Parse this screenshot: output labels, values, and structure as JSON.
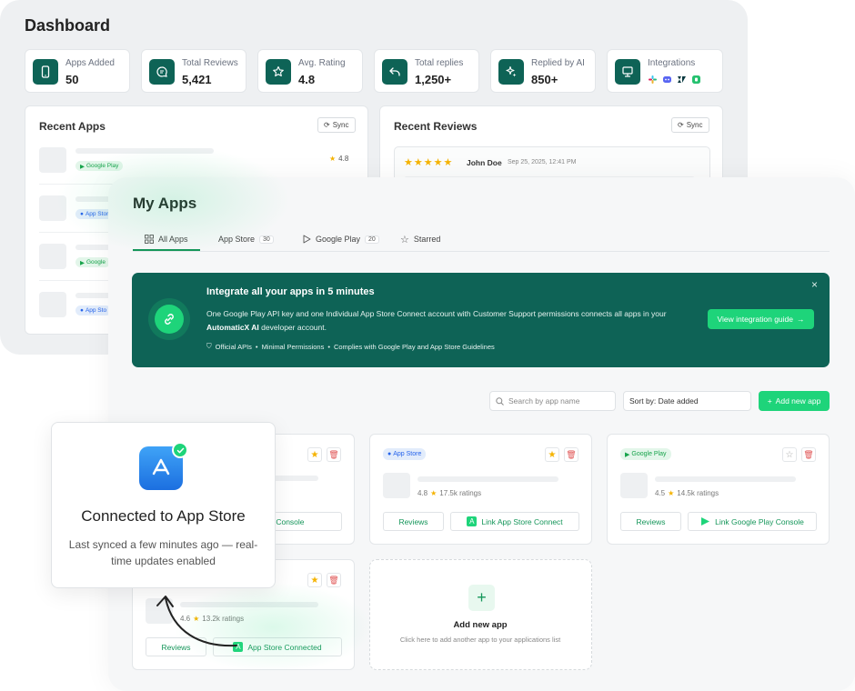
{
  "dashboard": {
    "title": "Dashboard",
    "stats": [
      {
        "label": "Apps Added",
        "value": "50",
        "icon": "phone-icon"
      },
      {
        "label": "Total Reviews",
        "value": "5,421",
        "icon": "chat-icon"
      },
      {
        "label": "Avg. Rating",
        "value": "4.8",
        "icon": "star-icon"
      },
      {
        "label": "Total replies",
        "value": "1,250+",
        "icon": "reply-icon"
      },
      {
        "label": "Replied by AI",
        "value": "850+",
        "icon": "sparkle-icon"
      },
      {
        "label": "Integrations",
        "value": "",
        "icon": "integrations-icon"
      }
    ],
    "recent_apps": {
      "title": "Recent Apps",
      "sync": "Sync",
      "rows": [
        {
          "badge": "Google Play",
          "rating": "4.8"
        },
        {
          "badge": "App Store"
        },
        {
          "badge": "Google"
        },
        {
          "badge": "App Sto"
        }
      ]
    },
    "recent_reviews": {
      "title": "Recent Reviews",
      "sync": "Sync",
      "reviewer": "John Doe",
      "date": "Sep 25, 2025, 12:41 PM"
    }
  },
  "my_apps": {
    "title": "My Apps",
    "tabs": [
      {
        "label": "All Apps",
        "count": ""
      },
      {
        "label": "App Store",
        "count": "30"
      },
      {
        "label": "Google Play",
        "count": "20"
      },
      {
        "label": "Starred",
        "count": ""
      }
    ],
    "banner": {
      "title": "Integrate all your apps in 5 minutes",
      "body_pre": "One Google Play API key and one Individual App Store Connect account with Customer Support permissions connects all apps in your",
      "body_bold": "AutomaticX AI",
      "body_post": "developer account.",
      "features": [
        "Official APIs",
        "Minimal Permissions",
        "Complies with Google Play and App Store Guidelines"
      ],
      "cta": "View integration guide"
    },
    "search_placeholder": "Search by app name",
    "sort_label": "Sort by: Date added",
    "add_button": "Add new app",
    "cards": [
      {
        "badge": "",
        "rating": "",
        "ratings": "",
        "reviews": "",
        "link": "le Play Console"
      },
      {
        "badge": "App Store",
        "rating": "4.8",
        "ratings": "17.5k ratings",
        "reviews": "Reviews",
        "link": "Link App Store Connect"
      },
      {
        "badge": "Google Play",
        "rating": "4.5",
        "ratings": "14.5k ratings",
        "reviews": "Reviews",
        "link": "Link Google Play Console"
      },
      {
        "badge": "",
        "rating": "4.6",
        "ratings": "13.2k ratings",
        "reviews": "Reviews",
        "link": "App Store Connected"
      }
    ],
    "add_card": {
      "title": "Add new app",
      "subtitle": "Click here to add another app to your applications list"
    }
  },
  "toast": {
    "title": "Connected to App Store",
    "body": "Last synced a few minutes ago — real-time updates enabled"
  },
  "colors": {
    "brand": "#0e6356",
    "accent": "#1ed47a",
    "star": "#f5b301"
  }
}
